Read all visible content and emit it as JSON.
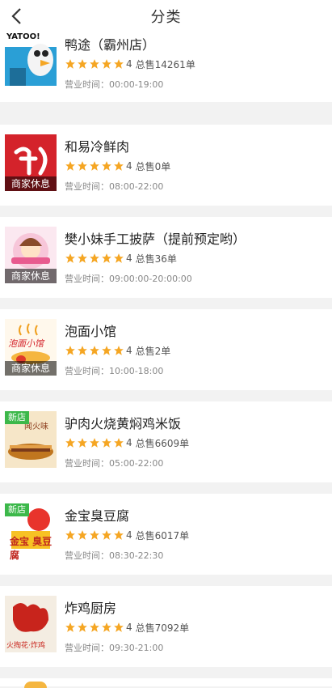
{
  "header": {
    "title": "分类"
  },
  "stores": [
    {
      "name": "鸭途（霸州店）",
      "score": "4",
      "sales": "总售14261单",
      "hours": "营业时间：00:00-19:00",
      "badge": "",
      "thumb_text": "YATOO!"
    },
    {
      "name": "和易冷鲜肉",
      "score": "4",
      "sales": "总售0单",
      "hours": "营业时间：08:00-22:00",
      "badge": "商家休息",
      "thumb_text": ""
    },
    {
      "name": "樊小妹手工披萨（提前预定哟）",
      "score": "4",
      "sales": "总售36单",
      "hours": "营业时间：09:00:00-20:00:00",
      "badge": "商家休息",
      "thumb_text": ""
    },
    {
      "name": "泡面小馆",
      "score": "4",
      "sales": "总售2单",
      "hours": "营业时间：10:00-18:00",
      "badge": "商家休息",
      "thumb_text": "泡面小馆"
    },
    {
      "name": "驴肉火烧黄焖鸡米饭",
      "score": "4",
      "sales": "总售6609单",
      "hours": "营业时间：05:00-22:00",
      "badge": "新店",
      "thumb_text": "闻火味"
    },
    {
      "name": "金宝臭豆腐",
      "score": "4",
      "sales": "总售6017单",
      "hours": "营业时间：08:30-22:30",
      "badge": "新店",
      "thumb_text": "金宝 臭豆腐"
    },
    {
      "name": "炸鸡厨房",
      "score": "4",
      "sales": "总售7092单",
      "hours": "营业时间：09:30-21:00",
      "badge": "",
      "thumb_text": "火掏花·炸鸡"
    }
  ],
  "colors": {
    "star": "#f5a623",
    "new_badge": "#3cb84a"
  }
}
